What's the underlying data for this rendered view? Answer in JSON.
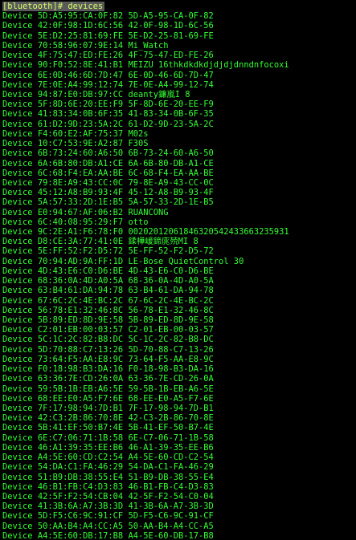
{
  "colors": {
    "background": "#000000",
    "foreground": "#33ff33",
    "prompt_background": "#5a5a5a",
    "prompt_foreground": "#d6ff6a"
  },
  "prompt": "[bluetooth]# devices",
  "device_word": "Device",
  "devices": [
    {
      "mac": "5D:A5:95:CA:0F:82",
      "name": "5D-A5-95-CA-0F-82"
    },
    {
      "mac": "42:0F:98:1D:6C:56",
      "name": "42-0F-98-1D-6C-56"
    },
    {
      "mac": "5E:D2:25:81:69:FE",
      "name": "5E-D2-25-81-69-FE"
    },
    {
      "mac": "70:58:96:07:9E:14",
      "name": "Mi_Watch"
    },
    {
      "mac": "4F:75:47:ED:FE:26",
      "name": "4F-75-47-ED-FE-26"
    },
    {
      "mac": "90:F0:52:8E:41:B1",
      "name": "MEIZU 16thkdkdkdjdjdjdnndnfocoxi"
    },
    {
      "mac": "6E:0D:46:6D:7D:47",
      "name": "6E-0D-46-6D-7D-47"
    },
    {
      "mac": "7E:0E:A4:99:12:74",
      "name": "7E-0E-A4-99-12-74"
    },
    {
      "mac": "94:87:E0:DB:97:CC",
      "name": "deanty鐮嵐I 8"
    },
    {
      "mac": "5F:8D:6E:20:EE:F9",
      "name": "5F-8D-6E-20-EE-F9"
    },
    {
      "mac": "41:83:34:0B:6F:35",
      "name": "41-83-34-0B-6F-35"
    },
    {
      "mac": "61:D2:9D:23:5A:2C",
      "name": "61-D2-9D-23-5A-2C"
    },
    {
      "mac": "F4:60:E2:AF:75:37",
      "name": "M02s"
    },
    {
      "mac": "10:C7:53:9E:A2:87",
      "name": "F30S"
    },
    {
      "mac": "6B:73:24:60:A6:50",
      "name": "6B-73-24-60-A6-50"
    },
    {
      "mac": "6A:6B:80:DB:A1:CE",
      "name": "6A-6B-80-DB-A1-CE"
    },
    {
      "mac": "6C:68:F4:EA:AA:BE",
      "name": "6C-68-F4-EA-AA-BE"
    },
    {
      "mac": "79:8E:A9:43:CC:0C",
      "name": "79-8E-A9-43-CC-0C"
    },
    {
      "mac": "45:12:A8:B9:93:4F",
      "name": "45-12-A8-B9-93-4F"
    },
    {
      "mac": "5A:57:33:2D:1E:B5",
      "name": "5A-57-33-2D-1E-B5"
    },
    {
      "mac": "E0:94:67:AF:06:B2",
      "name": "RUANCONG"
    },
    {
      "mac": "6C:40:08:95:29:F7",
      "name": "otto"
    },
    {
      "mac": "9C:2E:A1:F6:78:F0",
      "name": "002020120618463205424336632359​31"
    },
    {
      "mac": "D8:CE:3A:77:41:0E",
      "name": "鍒樺嵈鍗庣殑MI 8"
    },
    {
      "mac": "5E:FF:52:F2:D5:72",
      "name": "5E-FF-52-F2-D5-72"
    },
    {
      "mac": "70:94:AD:9A:FF:1D",
      "name": "LE-Bose QuietControl 30"
    },
    {
      "mac": "4D:43:E6:C0:D6:BE",
      "name": "4D-43-E6-C0-D6-BE"
    },
    {
      "mac": "68:36:0A:4D:A0:5A",
      "name": "68-36-0A-4D-A0-5A"
    },
    {
      "mac": "63:B4:61:DA:94:78",
      "name": "63-B4-61-DA-94-78"
    },
    {
      "mac": "67:6C:2C:4E:BC:2C",
      "name": "67-6C-2C-4E-BC-2C"
    },
    {
      "mac": "56:78:E1:32:46:8C",
      "name": "56-78-E1-32-46-8C"
    },
    {
      "mac": "5B:89:ED:8D:9E:58",
      "name": "5B-89-ED-8D-9E-58"
    },
    {
      "mac": "C2:01:EB:00:03:57",
      "name": "C2-01-EB-00-03-57"
    },
    {
      "mac": "5C:1C:2C:82:B8:DC",
      "name": "5C-1C-2C-82-B8-DC"
    },
    {
      "mac": "5D:70:88:C7:13:26",
      "name": "5D-70-88-C7-13-26"
    },
    {
      "mac": "73:64:F5:AA:E8:9C",
      "name": "73-64-F5-AA-E8-9C"
    },
    {
      "mac": "F0:18:98:B3:DA:16",
      "name": "F0-18-98-B3-DA-16"
    },
    {
      "mac": "63:36:7E:CD:26:0A",
      "name": "63-36-7E-CD-26-0A"
    },
    {
      "mac": "59:5B:1B:EB:A6:5E",
      "name": "59-5B-1B-EB-A6-5E"
    },
    {
      "mac": "68:EE:E0:A5:F7:6E",
      "name": "68-EE-E0-A5-F7-6E"
    },
    {
      "mac": "7F:17:98:94:7D:B1",
      "name": "7F-17-98-94-7D-B1"
    },
    {
      "mac": "42:C3:2B:86:70:8E",
      "name": "42-C3-2B-86-70-8E"
    },
    {
      "mac": "5B:41:EF:50:B7:4E",
      "name": "5B-41-EF-50-B7-4E"
    },
    {
      "mac": "6E:C7:06:71:1B:58",
      "name": "6E-C7-06-71-1B-58"
    },
    {
      "mac": "46:A1:39:35:EE:B6",
      "name": "46-A1-39-35-EE-B6"
    },
    {
      "mac": "A4:5E:60:CD:C2:54",
      "name": "A4-5E-60-CD-C2-54"
    },
    {
      "mac": "54:DA:C1:FA:46:29",
      "name": "54-DA-C1-FA-46-29"
    },
    {
      "mac": "51:B9:DB:38:55:E4",
      "name": "51-B9-DB-38-55-E4"
    },
    {
      "mac": "46:B1:FB:C4:D3:83",
      "name": "46-B1-FB-C4-D3-83"
    },
    {
      "mac": "42:5F:F2:54:CB:04",
      "name": "42-5F-F2-54-C0-04"
    },
    {
      "mac": "41:3B:6A:A7:3B:3D",
      "name": "41-3B-6A-A7-3B-3D"
    },
    {
      "mac": "5D:F5:C6:9C:91:CF",
      "name": "5D-F5-C6-9C-91-CF"
    },
    {
      "mac": "50:AA:B4:A4:CC:A5",
      "name": "50-AA-B4-A4-CC-A5"
    },
    {
      "mac": "A4:5E:60:DB:17:B8",
      "name": "A4-5E-60-DB-17-B8"
    },
    {
      "mac": "48:3A:7A:B0:65:E0",
      "name": "48-3A-7A-B0-65-E0"
    }
  ]
}
